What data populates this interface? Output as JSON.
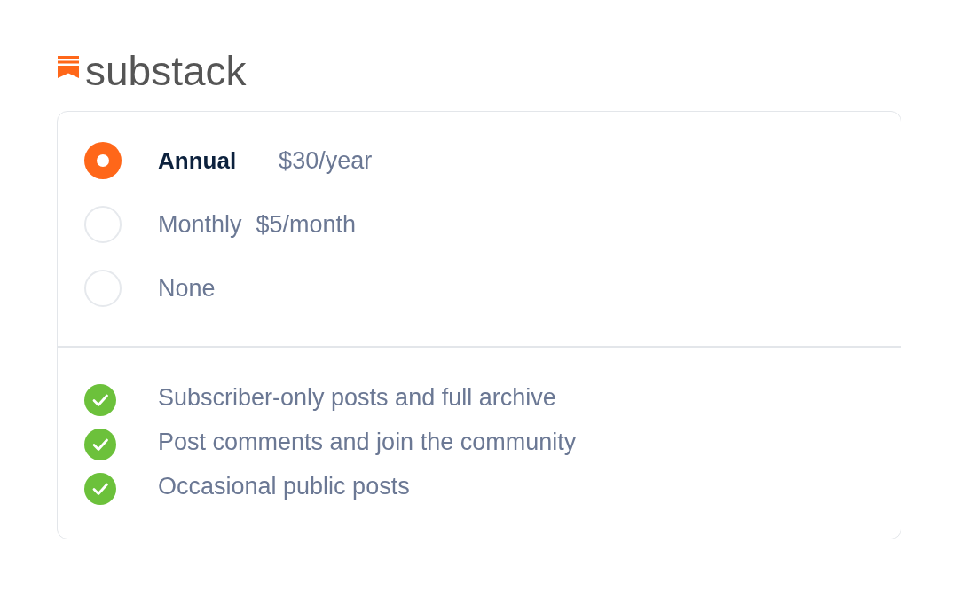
{
  "logo": {
    "wordmark": "substack"
  },
  "plans": [
    {
      "label": "Annual",
      "price": "$30/year",
      "selected": true
    },
    {
      "label": "Monthly",
      "price": "$5/month",
      "selected": false
    },
    {
      "label": "None",
      "selected": false
    }
  ],
  "benefits": [
    "Subscriber-only posts and full archive",
    "Post comments and join the community",
    "Occasional public posts"
  ]
}
